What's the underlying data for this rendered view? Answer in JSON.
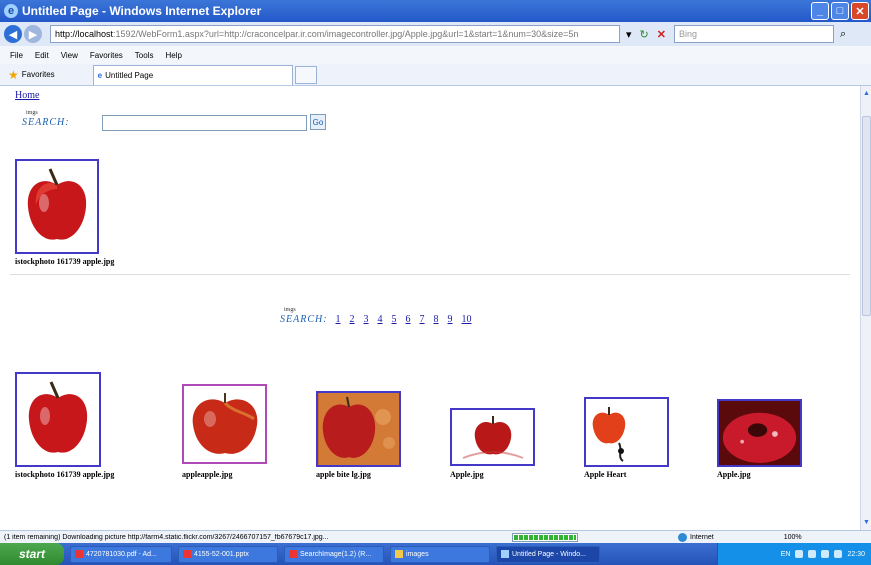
{
  "window": {
    "title": "Untitled Page - Windows Internet Explorer",
    "url_host": "http://localhost",
    "url_rest": ":1592/WebForm1.aspx?url=http://craconcelpar.ir.com/imagecontroller.jpg/Apple.jpg&url=1&start=1&num=30&size=5n"
  },
  "addressbar": {
    "search_placeholder": "Bing"
  },
  "menu": [
    "File",
    "Edit",
    "View",
    "Favorites",
    "Tools",
    "Help"
  ],
  "favorites": {
    "label": "Favorites",
    "tab_title": "Untitled Page"
  },
  "page": {
    "home_link": "Home",
    "logo_small": "imgs",
    "logo_text": "SEARCH:",
    "go_label": "Go",
    "top_result": {
      "caption": "istockphoto 161739 apple.jpg"
    },
    "pages": [
      "1",
      "2",
      "3",
      "4",
      "5",
      "6",
      "7",
      "8",
      "9",
      "10"
    ],
    "results": [
      {
        "caption": "istockphoto 161739 apple.jpg"
      },
      {
        "caption": "appleapple.jpg"
      },
      {
        "caption": "apple bite lg.jpg"
      },
      {
        "caption": "Apple.jpg"
      },
      {
        "caption": "Apple Heart"
      },
      {
        "caption": "Apple.jpg"
      }
    ]
  },
  "status": {
    "text": "(1 item remaining) Downloading picture http://farm4.static.flickr.com/3267/2466707157_fb67679c17.jpg...",
    "progress": 1.0,
    "zone": "Internet",
    "zoom": "100%"
  },
  "taskbar": {
    "start": "start",
    "tasks": [
      "4720781030.pdf - Ad...",
      "4155-52-001.pptx",
      "SearchImage(1.2) (R...",
      "images",
      "Untitled Page - Windo..."
    ],
    "lang": "EN",
    "time": "22:30"
  }
}
